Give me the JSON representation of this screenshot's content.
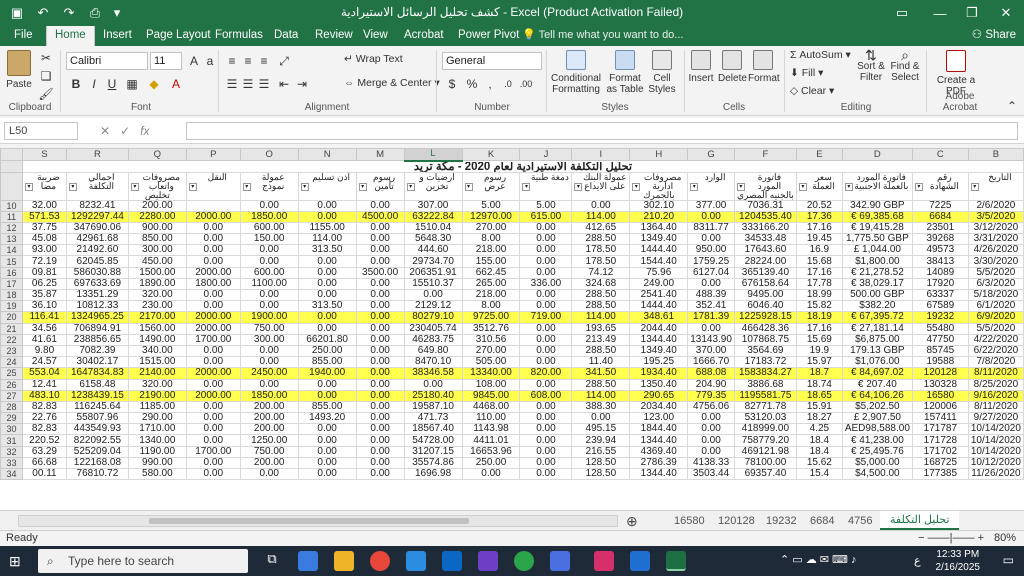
{
  "titlebar": {
    "title": "كشف تحليل الرسائل الاستيرادية - Excel (Product Activation Failed)"
  },
  "tabs": [
    "File",
    "Home",
    "Insert",
    "Page Layout",
    "Formulas",
    "Data",
    "Review",
    "View",
    "Acrobat",
    "Power Pivot"
  ],
  "tell_me": "Tell me what you want to do...",
  "share": "Share",
  "ribbon": {
    "clipboard": {
      "paste": "Paste",
      "label": "Clipboard"
    },
    "font": {
      "name": "Calibri",
      "size": "11",
      "label": "Font"
    },
    "alignment": {
      "wrap": "Wrap Text",
      "merge": "Merge & Center",
      "label": "Alignment"
    },
    "number": {
      "format": "General",
      "label": "Number"
    },
    "styles": {
      "conditional": "Conditional Formatting",
      "format_table": "Format as Table",
      "cell_styles": "Cell Styles",
      "label": "Styles"
    },
    "cells": {
      "insert": "Insert",
      "delete": "Delete",
      "format": "Format",
      "label": "Cells"
    },
    "editing": {
      "autosum": "AutoSum",
      "fill": "Fill",
      "clear": "Clear",
      "sort": "Sort & Filter",
      "find": "Find & Select",
      "label": "Editing"
    },
    "acrobat": {
      "create": "Create a PDF",
      "label": "Adobe Acrobat"
    }
  },
  "formula_bar": {
    "name_box": "L50",
    "fx": "fx"
  },
  "columns": [
    "S",
    "R",
    "Q",
    "P",
    "O",
    "N",
    "M",
    "L",
    "K",
    "J",
    "I",
    "H",
    "G",
    "F",
    "E",
    "D",
    "C",
    "B"
  ],
  "sheet_title": "تحليل التكلفة الاستيرادية لعام 2020 - مكة تريد",
  "headers": [
    "ضريبة مضا",
    "اجمالي التكلفة",
    "مصروفات واتعاب تخليص",
    "النقل",
    "عمولة نموذج",
    "اذن تسليم",
    "رسوم تأمين",
    "ارضيات و تخزين",
    "رسوم عرض",
    "دمغة طبية",
    "عمولة البنك على الايداع",
    "مصروفات ادارية بالجمرك",
    "الوارد",
    "فاتورة المورد بالجنيه المصري",
    "سعر العملة",
    "فاتورة المورد بالعملة الاجنبية",
    "رقم الشهادة",
    "التاريخ"
  ],
  "rows": [
    {
      "n": "10",
      "hl": false,
      "v": [
        "32.00",
        "8232.41",
        "200.00",
        "",
        "0.00",
        "0.00",
        "0.00",
        "307.00",
        "5.00",
        "5.00",
        "0.00",
        "302.10",
        "377.00",
        "7036.31",
        "20.52",
        "342.90 GBP",
        "7225",
        "2/6/2020"
      ]
    },
    {
      "n": "11",
      "hl": true,
      "v": [
        "571.53",
        "1292297.44",
        "2280.00",
        "2000.00",
        "1850.00",
        "0.00",
        "4500.00",
        "63222.84",
        "12970.00",
        "615.00",
        "114.00",
        "210.20",
        "0.00",
        "1204535.40",
        "17.36",
        "€ 69,385.68",
        "6684",
        "3/5/2020"
      ]
    },
    {
      "n": "12",
      "hl": false,
      "v": [
        "37.75",
        "347690.06",
        "900.00",
        "0.00",
        "600.00",
        "1155.00",
        "0.00",
        "1510.04",
        "270.00",
        "0.00",
        "412.65",
        "1364.40",
        "8311.77",
        "333166.20",
        "17.16",
        "€ 19,415.28",
        "23501",
        "3/12/2020"
      ]
    },
    {
      "n": "13",
      "hl": false,
      "v": [
        "45.08",
        "42961.68",
        "850.00",
        "0.00",
        "150.00",
        "114.00",
        "0.00",
        "5648.30",
        "8.00",
        "0.00",
        "288.50",
        "1349.40",
        "0.00",
        "34533.48",
        "19.45",
        "1,775.50 GBP",
        "39268",
        "3/31/2020"
      ]
    },
    {
      "n": "14",
      "hl": false,
      "v": [
        "93.00",
        "21492.60",
        "300.00",
        "0.00",
        "0.00",
        "313.50",
        "0.00",
        "444.60",
        "218.00",
        "0.00",
        "178.50",
        "1444.40",
        "950.00",
        "17643.60",
        "16.9",
        "£ 1,044.00",
        "49573",
        "4/26/2020"
      ]
    },
    {
      "n": "15",
      "hl": false,
      "v": [
        "72.19",
        "62045.85",
        "450.00",
        "0.00",
        "0.00",
        "0.00",
        "0.00",
        "29734.70",
        "155.00",
        "0.00",
        "178.50",
        "1544.40",
        "1759.25",
        "28224.00",
        "15.68",
        "$1,800.00",
        "38413",
        "3/30/2020"
      ]
    },
    {
      "n": "16",
      "hl": false,
      "v": [
        "09.81",
        "586030.88",
        "1500.00",
        "2000.00",
        "600.00",
        "0.00",
        "3500.00",
        "206351.91",
        "662.45",
        "0.00",
        "74.12",
        "75.96",
        "6127.04",
        "365139.40",
        "17.16",
        "€ 21,278.52",
        "14089",
        "5/5/2020"
      ]
    },
    {
      "n": "17",
      "hl": false,
      "v": [
        "06.25",
        "697633.69",
        "1890.00",
        "1800.00",
        "1100.00",
        "0.00",
        "0.00",
        "15510.37",
        "265.00",
        "336.00",
        "324.68",
        "249.00",
        "0.00",
        "676158.64",
        "17.78",
        "€ 38,029.17",
        "17920",
        "6/3/2020"
      ]
    },
    {
      "n": "18",
      "hl": false,
      "v": [
        "35.87",
        "13351.29",
        "320.00",
        "0.00",
        "0.00",
        "0.00",
        "0.00",
        "0.00",
        "218.00",
        "0.00",
        "288.50",
        "2541.40",
        "488.39",
        "9495.00",
        "18.99",
        "500.00 GBP",
        "63337",
        "5/18/2020"
      ]
    },
    {
      "n": "19",
      "hl": false,
      "v": [
        "36.10",
        "10812.33",
        "230.00",
        "0.00",
        "0.00",
        "313.50",
        "0.00",
        "2129.12",
        "8.00",
        "0.00",
        "288.50",
        "1444.40",
        "352.41",
        "6046.40",
        "15.82",
        "$382.20",
        "67589",
        "6/1/2020"
      ]
    },
    {
      "n": "20",
      "hl": true,
      "v": [
        "116.41",
        "1324965.25",
        "2170.00",
        "2000.00",
        "1900.00",
        "0.00",
        "0.00",
        "80279.10",
        "9725.00",
        "719.00",
        "114.00",
        "348.61",
        "1781.39",
        "1225928.15",
        "18.19",
        "€ 67,395.72",
        "19232",
        "6/9/2020"
      ]
    },
    {
      "n": "21",
      "hl": false,
      "v": [
        "34.56",
        "706894.91",
        "1560.00",
        "2000.00",
        "750.00",
        "0.00",
        "0.00",
        "230405.74",
        "3512.76",
        "0.00",
        "193.65",
        "2044.40",
        "0.00",
        "466428.36",
        "17.16",
        "€ 27,181.14",
        "55480",
        "5/5/2020"
      ]
    },
    {
      "n": "22",
      "hl": false,
      "v": [
        "41.61",
        "238856.65",
        "1490.00",
        "1700.00",
        "300.00",
        "66201.80",
        "0.00",
        "46283.75",
        "310.56",
        "0.00",
        "213.49",
        "1344.40",
        "13143.90",
        "107868.75",
        "15.69",
        "$6,875.00",
        "47750",
        "4/22/2020"
      ]
    },
    {
      "n": "23",
      "hl": false,
      "v": [
        "9.80",
        "7082.39",
        "340.00",
        "0.00",
        "0.00",
        "250.00",
        "0.00",
        "649.80",
        "270.00",
        "0.00",
        "288.50",
        "1349.40",
        "370.00",
        "3564.69",
        "19.9",
        "179.13 GBP",
        "85745",
        "6/22/2020"
      ]
    },
    {
      "n": "24",
      "hl": false,
      "v": [
        "24.57",
        "30402.17",
        "1515.00",
        "0.00",
        "0.00",
        "855.00",
        "0.00",
        "8470.10",
        "505.00",
        "0.00",
        "11.40",
        "195.25",
        "1666.70",
        "17183.72",
        "15.97",
        "$1,076.00",
        "19588",
        "7/8/2020"
      ]
    },
    {
      "n": "25",
      "hl": true,
      "v": [
        "553.04",
        "1647834.83",
        "2140.00",
        "2000.00",
        "2450.00",
        "1940.00",
        "0.00",
        "38346.58",
        "13340.00",
        "820.00",
        "341.50",
        "1934.40",
        "688.08",
        "1583834.27",
        "18.7",
        "€ 84,697.02",
        "120128",
        "8/11/2020"
      ]
    },
    {
      "n": "26",
      "hl": false,
      "v": [
        "12.41",
        "6158.48",
        "320.00",
        "0.00",
        "0.00",
        "0.00",
        "0.00",
        "0.00",
        "108.00",
        "0.00",
        "288.50",
        "1350.40",
        "204.90",
        "3886.68",
        "18.74",
        "€ 207.40",
        "130328",
        "8/25/2020"
      ]
    },
    {
      "n": "27",
      "hl": true,
      "v": [
        "483.10",
        "1238439.15",
        "2190.00",
        "2000.00",
        "1850.00",
        "0.00",
        "0.00",
        "25180.40",
        "9845.00",
        "608.00",
        "114.00",
        "290.65",
        "779.35",
        "1195581.75",
        "18.65",
        "€ 64,106.26",
        "16580",
        "9/16/2020"
      ]
    },
    {
      "n": "28",
      "hl": false,
      "v": [
        "82.83",
        "116245.64",
        "1185.00",
        "0.00",
        "200.00",
        "855.00",
        "0.00",
        "19587.10",
        "4468.00",
        "0.00",
        "388.30",
        "2034.40",
        "4756.06",
        "82771.78",
        "15.91",
        "$5,202.50",
        "120006",
        "8/11/2020"
      ]
    },
    {
      "n": "29",
      "hl": false,
      "v": [
        "22.76",
        "55807.96",
        "290.00",
        "0.00",
        "200.00",
        "1493.20",
        "0.00",
        "471.73",
        "110.00",
        "0.00",
        "0.00",
        "123.00",
        "0.00",
        "53120.03",
        "18.27",
        "£ 2,907.50",
        "157411",
        "9/27/2020"
      ]
    },
    {
      "n": "30",
      "hl": false,
      "v": [
        "82.83",
        "443549.93",
        "1710.00",
        "0.00",
        "200.00",
        "0.00",
        "0.00",
        "18567.40",
        "1143.98",
        "0.00",
        "495.15",
        "1844.40",
        "0.00",
        "418999.00",
        "4.25",
        "AED98,588.00",
        "171787",
        "10/14/2020"
      ]
    },
    {
      "n": "31",
      "hl": false,
      "v": [
        "220.52",
        "822092.55",
        "1340.00",
        "0.00",
        "1250.00",
        "0.00",
        "0.00",
        "54728.00",
        "4411.01",
        "0.00",
        "239.94",
        "1344.40",
        "0.00",
        "758779.20",
        "18.4",
        "€ 41,238.00",
        "171728",
        "10/14/2020"
      ]
    },
    {
      "n": "32",
      "hl": false,
      "v": [
        "63.29",
        "525209.04",
        "1190.00",
        "1700.00",
        "750.00",
        "0.00",
        "0.00",
        "31207.15",
        "16653.96",
        "0.00",
        "216.55",
        "4369.40",
        "0.00",
        "469121.98",
        "18.4",
        "€ 25,495.76",
        "171702",
        "10/14/2020"
      ]
    },
    {
      "n": "33",
      "hl": false,
      "v": [
        "66.68",
        "122168.08",
        "990.00",
        "0.00",
        "200.00",
        "0.00",
        "0.00",
        "35574.86",
        "250.00",
        "0.00",
        "128.50",
        "2786.39",
        "4138.33",
        "78100.00",
        "15.62",
        "$5,000.00",
        "168725",
        "10/12/2020"
      ]
    },
    {
      "n": "34",
      "hl": false,
      "v": [
        "00.11",
        "76810.72",
        "580.00",
        "0.00",
        "0.00",
        "0.00",
        "0.00",
        "1696.98",
        "0.00",
        "0.00",
        "128.50",
        "1344.40",
        "3503.44",
        "69357.40",
        "15.4",
        "$4,500.00",
        "177385",
        "11/26/2020"
      ]
    }
  ],
  "sheet_tabs": {
    "numbers": [
      "16580",
      "120128",
      "19232",
      "6684",
      "4756"
    ],
    "active": "تحليل التكلفة"
  },
  "status": {
    "ready": "Ready",
    "zoom": "80%"
  },
  "taskbar": {
    "search": "Type here to search",
    "time": "12:33 PM",
    "date": "2/16/2025",
    "lang": "ع"
  }
}
